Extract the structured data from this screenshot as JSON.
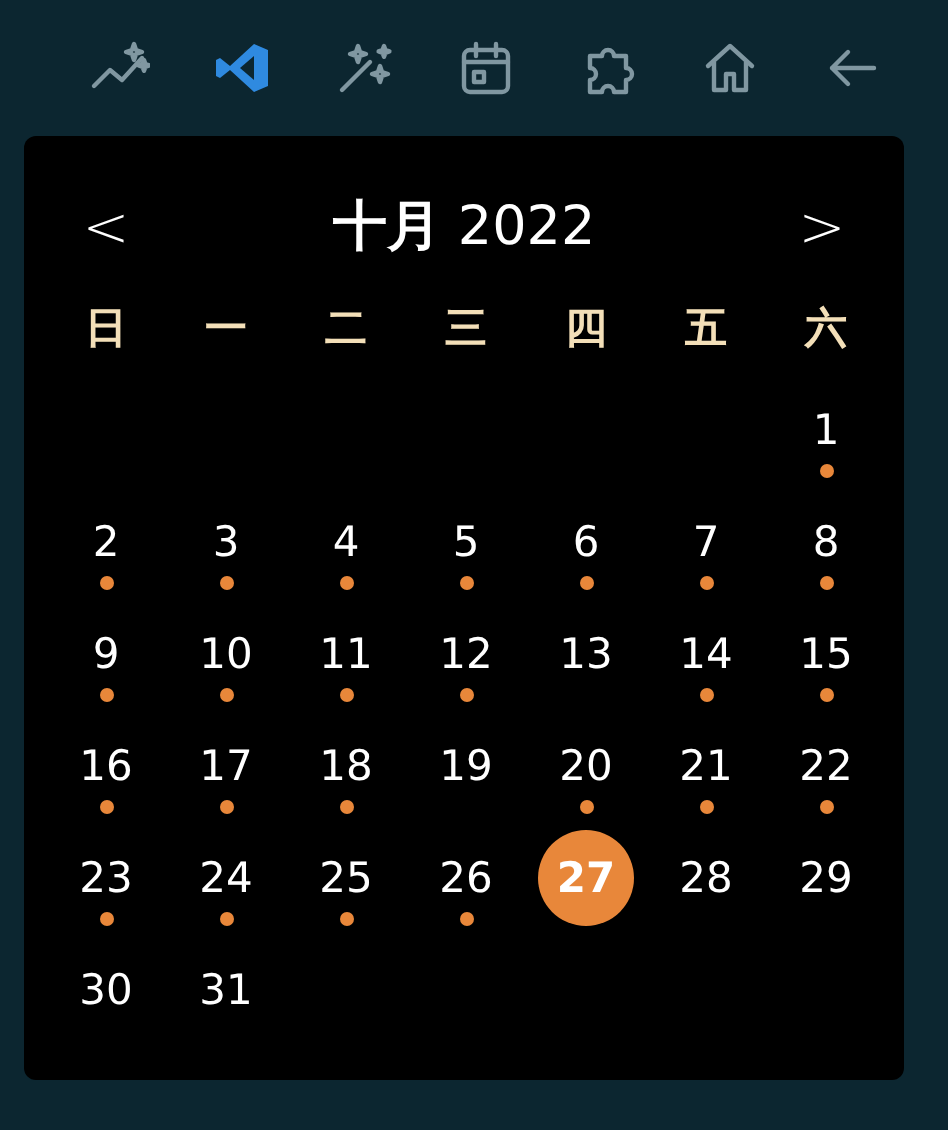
{
  "toolbar": [
    {
      "kind": "trend",
      "selected": false
    },
    {
      "kind": "code",
      "selected": true
    },
    {
      "kind": "wand",
      "selected": false
    },
    {
      "kind": "calendar",
      "selected": false
    },
    {
      "kind": "puzzle",
      "selected": false
    },
    {
      "kind": "home",
      "selected": false
    },
    {
      "kind": "back",
      "selected": false
    }
  ],
  "calendar": {
    "prev": "<",
    "title": "**十月** 2022",
    "next": ">",
    "weekdays": [
      "日",
      "一",
      "二",
      "三",
      "四",
      "五",
      "六"
    ],
    "weeks": [
      {
        "kind": "lead",
        "days": [
          {
            "day": "1",
            "marked": true,
            "selected": false
          }
        ]
      },
      {
        "kind": "week",
        "days": [
          {
            "day": "2",
            "marked": true,
            "selected": false
          },
          {
            "day": "3",
            "marked": true,
            "selected": false
          },
          {
            "day": "4",
            "marked": true,
            "selected": false
          },
          {
            "day": "5",
            "marked": true,
            "selected": false
          },
          {
            "day": "6",
            "marked": true,
            "selected": false
          },
          {
            "day": "7",
            "marked": true,
            "selected": false
          },
          {
            "day": "8",
            "marked": true,
            "selected": false
          }
        ]
      },
      {
        "kind": "week",
        "days": [
          {
            "day": "9",
            "marked": true,
            "selected": false
          },
          {
            "day": "10",
            "marked": true,
            "selected": false
          },
          {
            "day": "11",
            "marked": true,
            "selected": false
          },
          {
            "day": "12",
            "marked": true,
            "selected": false
          },
          {
            "day": "13",
            "marked": false,
            "selected": false
          },
          {
            "day": "14",
            "marked": true,
            "selected": false
          },
          {
            "day": "15",
            "marked": true,
            "selected": false
          }
        ]
      },
      {
        "kind": "week",
        "days": [
          {
            "day": "16",
            "marked": true,
            "selected": false
          },
          {
            "day": "17",
            "marked": true,
            "selected": false
          },
          {
            "day": "18",
            "marked": true,
            "selected": false
          },
          {
            "day": "19",
            "marked": false,
            "selected": false
          },
          {
            "day": "20",
            "marked": true,
            "selected": false
          },
          {
            "day": "21",
            "marked": true,
            "selected": false
          },
          {
            "day": "22",
            "marked": true,
            "selected": false
          }
        ]
      },
      {
        "kind": "week",
        "days": [
          {
            "day": "23",
            "marked": true,
            "selected": false
          },
          {
            "day": "24",
            "marked": true,
            "selected": false
          },
          {
            "day": "25",
            "marked": true,
            "selected": false
          },
          {
            "day": "26",
            "marked": true,
            "selected": false
          },
          {
            "day": "27",
            "marked": false,
            "selected": true
          },
          {
            "day": "28",
            "marked": false,
            "selected": false
          },
          {
            "day": "29",
            "marked": false,
            "selected": false
          }
        ]
      },
      {
        "kind": "week",
        "days": [
          {
            "day": "30",
            "marked": false,
            "selected": false
          },
          {
            "day": "31",
            "marked": false,
            "selected": false
          }
        ]
      }
    ]
  }
}
